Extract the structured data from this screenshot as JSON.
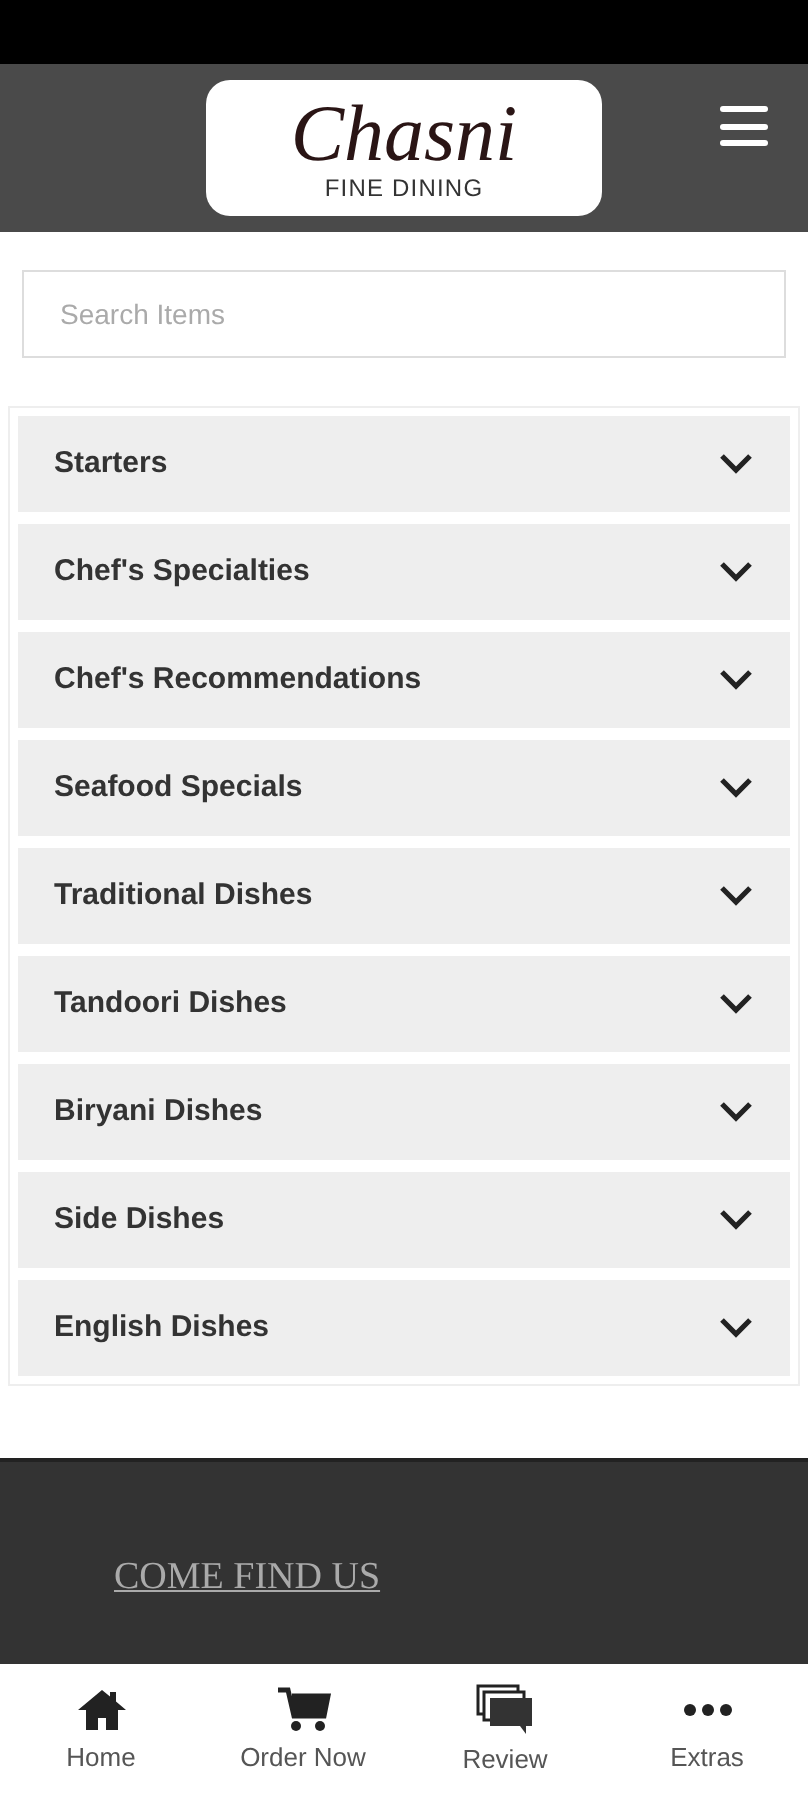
{
  "header": {
    "logo_title": "Chasni",
    "logo_subtitle": "FINE DINING"
  },
  "search": {
    "placeholder": "Search Items"
  },
  "categories": [
    {
      "label": "Starters",
      "expanded": false
    },
    {
      "label": "Chef's Specialties",
      "expanded": false
    },
    {
      "label": "Chef's Recommendations",
      "expanded": false
    },
    {
      "label": "Seafood Specials",
      "expanded": false
    },
    {
      "label": "Traditional Dishes",
      "expanded": false
    },
    {
      "label": "Tandoori Dishes",
      "expanded": false
    },
    {
      "label": "Biryani Dishes",
      "expanded": false
    },
    {
      "label": "Side Dishes",
      "expanded": false
    },
    {
      "label": "English Dishes",
      "expanded": false
    }
  ],
  "footer": {
    "heading": "COME FIND US"
  },
  "bottom_nav": [
    {
      "kind": "home",
      "label": "Home"
    },
    {
      "kind": "cart",
      "label": "Order Now"
    },
    {
      "kind": "chat",
      "label": "Review"
    },
    {
      "kind": "more",
      "label": "Extras"
    }
  ]
}
